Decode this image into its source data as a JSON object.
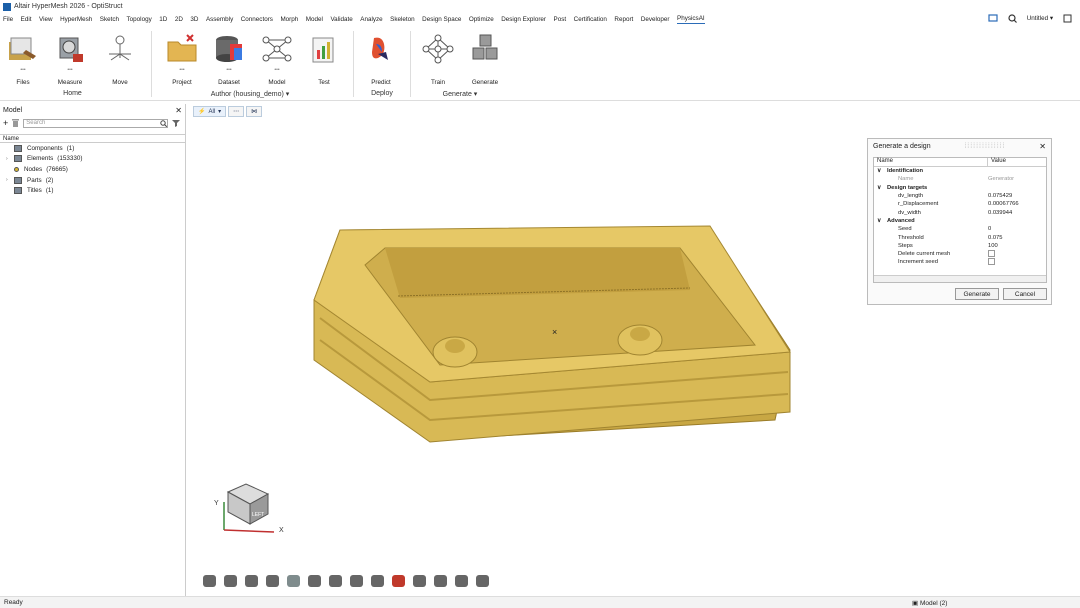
{
  "window": {
    "title": "Altair HyperMesh 2026 - OptiStruct"
  },
  "menu": [
    "File",
    "Edit",
    "View",
    "HyperMesh",
    "Sketch",
    "Topology",
    "1D",
    "2D",
    "3D",
    "Assembly",
    "Connectors",
    "Morph",
    "Model",
    "Validate",
    "Analyze",
    "Skeleton",
    "Design Space",
    "Optimize",
    "Design Explorer",
    "Post",
    "Certification",
    "Report",
    "Developer",
    "PhysicsAI"
  ],
  "menu_active": "PhysicsAI",
  "topright": {
    "session": "Untitled"
  },
  "ribbon": {
    "files": "Files",
    "measure": "Measure",
    "move": "Move",
    "project": "Project",
    "dataset": "Dataset",
    "model": "Model",
    "test": "Test",
    "predict": "Predict",
    "train": "Train",
    "generate": "Generate",
    "groups": {
      "home": "Home",
      "author": "Author (housing_demo)",
      "deploy": "Deploy",
      "generate": "Generate"
    }
  },
  "model_panel": {
    "title": "Model",
    "search_placeholder": "Search",
    "column": "Name",
    "items": [
      {
        "label": "Components",
        "count": "(1)"
      },
      {
        "label": "Elements",
        "count": "(153330)"
      },
      {
        "label": "Nodes",
        "count": "(76665)"
      },
      {
        "label": "Parts",
        "count": "(2)"
      },
      {
        "label": "Titles",
        "count": "(1)"
      }
    ]
  },
  "view_toolbar": {
    "filter": "All"
  },
  "dialog": {
    "title": "Generate a design",
    "col_name": "Name",
    "col_value": "Value",
    "sections": {
      "identification": "Identification",
      "design_targets": "Design targets",
      "advanced": "Advanced"
    },
    "rows": {
      "name": {
        "label": "Name",
        "value": "Generator"
      },
      "dv_length": {
        "label": "dv_length",
        "value": "0.075429"
      },
      "r_disp": {
        "label": "r_Displacement",
        "value": "0.00067766"
      },
      "dv_width": {
        "label": "dv_width",
        "value": "0.039944"
      },
      "seed": {
        "label": "Seed",
        "value": "0"
      },
      "threshold": {
        "label": "Threshold",
        "value": "0.075"
      },
      "steps": {
        "label": "Steps",
        "value": "100"
      },
      "delete": {
        "label": "Delete current mesh"
      },
      "increment": {
        "label": "Increment seed"
      }
    },
    "generate_btn": "Generate",
    "cancel_btn": "Cancel"
  },
  "triad": {
    "x": "X",
    "y": "Y",
    "cube_face": "LEFT"
  },
  "status": {
    "text": "Ready",
    "model_tab": "Model (2)"
  },
  "colors": {
    "part": "#d6b85a",
    "accent": "#2b6cb8"
  }
}
